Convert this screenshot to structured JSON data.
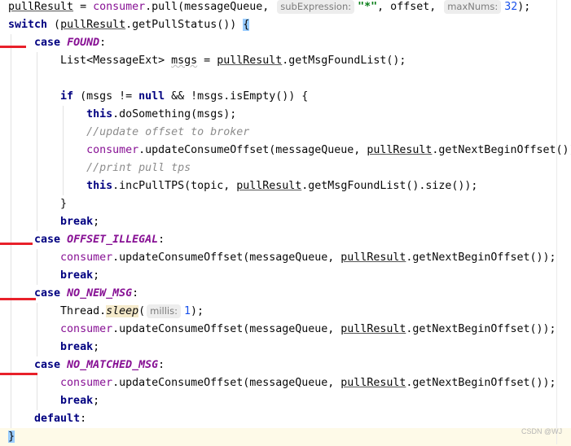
{
  "editor": {
    "current_line_index": 24,
    "watermark": "CSDN @WJ",
    "lines": [
      [
        [
          "ul",
          "pullResult"
        ],
        [
          "plain",
          " = "
        ],
        [
          "field",
          "consumer"
        ],
        [
          "plain",
          ".pull(messageQueue, "
        ],
        [
          "hint",
          "subExpression:"
        ],
        [
          "str",
          "\"*\""
        ],
        [
          "plain",
          ", offset, "
        ],
        [
          "hint",
          "maxNums:"
        ],
        [
          "num",
          "32"
        ],
        [
          "plain",
          ");"
        ]
      ],
      [
        [
          "kw",
          "switch"
        ],
        [
          "plain",
          " ("
        ],
        [
          "ul",
          "pullResult"
        ],
        [
          "plain",
          ".getPullStatus()) "
        ],
        [
          "brace",
          "{"
        ]
      ],
      [
        [
          "plain",
          "    "
        ],
        [
          "kw",
          "case"
        ],
        [
          "plain",
          " "
        ],
        [
          "const",
          "FOUND"
        ],
        [
          "plain",
          ":"
        ]
      ],
      [
        [
          "plain",
          "        List<MessageExt> "
        ],
        [
          "warn",
          "msgs"
        ],
        [
          "plain",
          " = "
        ],
        [
          "ul",
          "pullResult"
        ],
        [
          "plain",
          ".getMsgFoundList();"
        ]
      ],
      [],
      [
        [
          "plain",
          "        "
        ],
        [
          "kw",
          "if"
        ],
        [
          "plain",
          " (msgs != "
        ],
        [
          "kw",
          "null"
        ],
        [
          "plain",
          " && !msgs.isEmpty()) {"
        ]
      ],
      [
        [
          "plain",
          "            "
        ],
        [
          "kw",
          "this"
        ],
        [
          "plain",
          ".doSomething(msgs);"
        ]
      ],
      [
        [
          "plain",
          "            "
        ],
        [
          "comment",
          "//update offset to broker"
        ]
      ],
      [
        [
          "plain",
          "            "
        ],
        [
          "field",
          "consumer"
        ],
        [
          "plain",
          ".updateConsumeOffset(messageQueue, "
        ],
        [
          "ul",
          "pullResult"
        ],
        [
          "plain",
          ".getNextBeginOffset());"
        ]
      ],
      [
        [
          "plain",
          "            "
        ],
        [
          "comment",
          "//print pull tps"
        ]
      ],
      [
        [
          "plain",
          "            "
        ],
        [
          "kw",
          "this"
        ],
        [
          "plain",
          ".incPullTPS(topic, "
        ],
        [
          "ul",
          "pullResult"
        ],
        [
          "plain",
          ".getMsgFoundList().size());"
        ]
      ],
      [
        [
          "plain",
          "        }"
        ]
      ],
      [
        [
          "plain",
          "        "
        ],
        [
          "kw",
          "break"
        ],
        [
          "plain",
          ";"
        ]
      ],
      [
        [
          "plain",
          "    "
        ],
        [
          "kw",
          "case"
        ],
        [
          "plain",
          " "
        ],
        [
          "const",
          "OFFSET_ILLEGAL"
        ],
        [
          "plain",
          ":"
        ]
      ],
      [
        [
          "plain",
          "        "
        ],
        [
          "field",
          "consumer"
        ],
        [
          "plain",
          ".updateConsumeOffset(messageQueue, "
        ],
        [
          "ul",
          "pullResult"
        ],
        [
          "plain",
          ".getNextBeginOffset());"
        ]
      ],
      [
        [
          "plain",
          "        "
        ],
        [
          "kw",
          "break"
        ],
        [
          "plain",
          ";"
        ]
      ],
      [
        [
          "plain",
          "    "
        ],
        [
          "kw",
          "case"
        ],
        [
          "plain",
          " "
        ],
        [
          "const",
          "NO_NEW_MSG"
        ],
        [
          "plain",
          ":"
        ]
      ],
      [
        [
          "plain",
          "        Thread."
        ],
        [
          "static",
          "sleep"
        ],
        [
          "plain",
          "("
        ],
        [
          "hint",
          "millis:"
        ],
        [
          "num",
          "1"
        ],
        [
          "plain",
          ");"
        ]
      ],
      [
        [
          "plain",
          "        "
        ],
        [
          "field",
          "consumer"
        ],
        [
          "plain",
          ".updateConsumeOffset(messageQueue, "
        ],
        [
          "ul",
          "pullResult"
        ],
        [
          "plain",
          ".getNextBeginOffset());"
        ]
      ],
      [
        [
          "plain",
          "        "
        ],
        [
          "kw",
          "break"
        ],
        [
          "plain",
          ";"
        ]
      ],
      [
        [
          "plain",
          "    "
        ],
        [
          "kw",
          "case"
        ],
        [
          "plain",
          " "
        ],
        [
          "const",
          "NO_MATCHED_MSG"
        ],
        [
          "plain",
          ":"
        ]
      ],
      [
        [
          "plain",
          "        "
        ],
        [
          "field",
          "consumer"
        ],
        [
          "plain",
          ".updateConsumeOffset(messageQueue, "
        ],
        [
          "ul",
          "pullResult"
        ],
        [
          "plain",
          ".getNextBeginOffset());"
        ]
      ],
      [
        [
          "plain",
          "        "
        ],
        [
          "kw",
          "break"
        ],
        [
          "plain",
          ";"
        ]
      ],
      [
        [
          "plain",
          "    "
        ],
        [
          "kw",
          "default"
        ],
        [
          "plain",
          ":"
        ]
      ],
      [
        [
          "brace",
          "}"
        ]
      ]
    ]
  },
  "annotations": {
    "color": "#e8202a",
    "marked_cases": [
      "FOUND",
      "OFFSET_ILLEGAL",
      "NO_NEW_MSG",
      "NO_MATCHED_MSG"
    ]
  }
}
